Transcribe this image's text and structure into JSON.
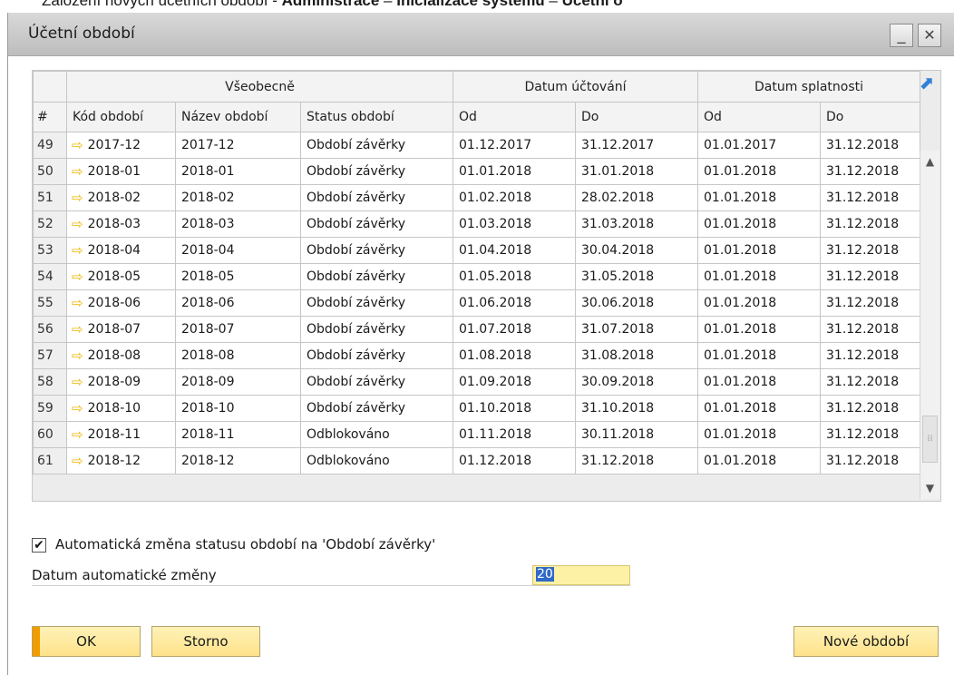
{
  "caption": {
    "prefix": "Založení nových účetních období - ",
    "path1": "Administrace",
    "sep1": " – ",
    "path2": "Inicializace systému",
    "sep2": " – ",
    "path3": "Účetní o"
  },
  "window": {
    "title": "Účetní období",
    "minimize": "_",
    "close": "✕"
  },
  "grid": {
    "group_headers": [
      "Všeobecně",
      "Datum účtování",
      "Datum splatnosti"
    ],
    "columns": [
      "#",
      "Kód období",
      "Název období",
      "Status období",
      "Od",
      "Do",
      "Od",
      "Do"
    ],
    "rows": [
      {
        "n": "49",
        "code": "2017-12",
        "name": "2017-12",
        "status": "Období závěrky",
        "from": "01.12.2017",
        "to": "31.12.2017",
        "due_from": "01.01.2017",
        "due_to": "31.12.2018"
      },
      {
        "n": "50",
        "code": "2018-01",
        "name": "2018-01",
        "status": "Období závěrky",
        "from": "01.01.2018",
        "to": "31.01.2018",
        "due_from": "01.01.2018",
        "due_to": "31.12.2018"
      },
      {
        "n": "51",
        "code": "2018-02",
        "name": "2018-02",
        "status": "Období závěrky",
        "from": "01.02.2018",
        "to": "28.02.2018",
        "due_from": "01.01.2018",
        "due_to": "31.12.2018"
      },
      {
        "n": "52",
        "code": "2018-03",
        "name": "2018-03",
        "status": "Období závěrky",
        "from": "01.03.2018",
        "to": "31.03.2018",
        "due_from": "01.01.2018",
        "due_to": "31.12.2018"
      },
      {
        "n": "53",
        "code": "2018-04",
        "name": "2018-04",
        "status": "Období závěrky",
        "from": "01.04.2018",
        "to": "30.04.2018",
        "due_from": "01.01.2018",
        "due_to": "31.12.2018"
      },
      {
        "n": "54",
        "code": "2018-05",
        "name": "2018-05",
        "status": "Období závěrky",
        "from": "01.05.2018",
        "to": "31.05.2018",
        "due_from": "01.01.2018",
        "due_to": "31.12.2018"
      },
      {
        "n": "55",
        "code": "2018-06",
        "name": "2018-06",
        "status": "Období závěrky",
        "from": "01.06.2018",
        "to": "30.06.2018",
        "due_from": "01.01.2018",
        "due_to": "31.12.2018"
      },
      {
        "n": "56",
        "code": "2018-07",
        "name": "2018-07",
        "status": "Období závěrky",
        "from": "01.07.2018",
        "to": "31.07.2018",
        "due_from": "01.01.2018",
        "due_to": "31.12.2018"
      },
      {
        "n": "57",
        "code": "2018-08",
        "name": "2018-08",
        "status": "Období závěrky",
        "from": "01.08.2018",
        "to": "31.08.2018",
        "due_from": "01.01.2018",
        "due_to": "31.12.2018"
      },
      {
        "n": "58",
        "code": "2018-09",
        "name": "2018-09",
        "status": "Období závěrky",
        "from": "01.09.2018",
        "to": "30.09.2018",
        "due_from": "01.01.2018",
        "due_to": "31.12.2018"
      },
      {
        "n": "59",
        "code": "2018-10",
        "name": "2018-10",
        "status": "Období závěrky",
        "from": "01.10.2018",
        "to": "31.10.2018",
        "due_from": "01.01.2018",
        "due_to": "31.12.2018"
      },
      {
        "n": "60",
        "code": "2018-11",
        "name": "2018-11",
        "status": "Odblokováno",
        "from": "01.11.2018",
        "to": "30.11.2018",
        "due_from": "01.01.2018",
        "due_to": "31.12.2018"
      },
      {
        "n": "61",
        "code": "2018-12",
        "name": "2018-12",
        "status": "Odblokováno",
        "from": "01.12.2018",
        "to": "31.12.2018",
        "due_from": "01.01.2018",
        "due_to": "31.12.2018"
      }
    ]
  },
  "auto_change": {
    "checked": true,
    "check_mark": "✔",
    "label": "Automatická změna statusu období na 'Období závěrky'",
    "date_label": "Datum automatické změny",
    "date_value": "20"
  },
  "buttons": {
    "ok": "OK",
    "cancel": "Storno",
    "new_period": "Nové období"
  },
  "icons": {
    "row_arrow": "arrow-right-icon",
    "expand": "expand-icon"
  },
  "colors": {
    "button_bg": "#fde28a",
    "ok_accent": "#f19c00",
    "input_bg": "#fdf1a6",
    "arrow": "#f0b400",
    "expand_icon": "#2f7fd8"
  }
}
